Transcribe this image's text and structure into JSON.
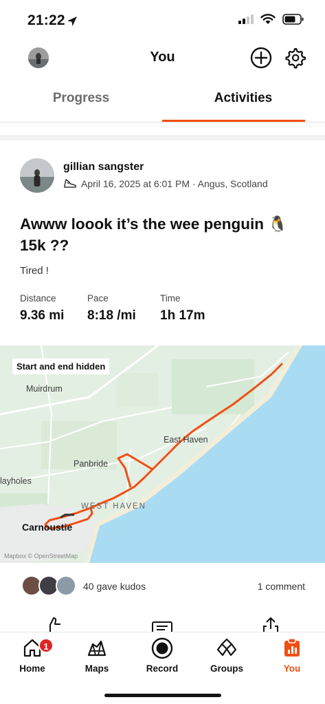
{
  "status_bar": {
    "time": "21:22",
    "location_icon": "location-arrow-icon",
    "signal_icon": "signal-icon",
    "wifi_icon": "wifi-icon",
    "battery_icon": "battery-icon"
  },
  "header": {
    "title": "You",
    "avatar_icon": "profile-avatar",
    "add_icon": "plus-circle-icon",
    "settings_icon": "gear-icon"
  },
  "tabs": [
    {
      "label": "Progress"
    },
    {
      "label": "Activities",
      "active": true
    }
  ],
  "activity": {
    "athlete": "gillian sangster",
    "meta": "April 16, 2025 at 6:01 PM · Angus, Scotland",
    "sport_icon": "shoe-icon",
    "title": "Awww loook it’s the wee penguin 🐧 15k ??",
    "description": "Tired !",
    "stats": [
      {
        "label": "Distance",
        "value": "9.36 mi"
      },
      {
        "label": "Pace",
        "value": "8:18 /mi"
      },
      {
        "label": "Time",
        "value": "1h 17m"
      }
    ],
    "map": {
      "privacy_badge": "Start and end hidden",
      "places": [
        "Muirdrum",
        "East Haven",
        "Panbride",
        "layholes",
        "WEST HAVEN",
        "Carnoustie"
      ],
      "attribution": "Mapbox © OpenStreetMap",
      "route_color": "#f24e12",
      "sea_color": "#a9dcf3",
      "land_color": "#e2efe2"
    },
    "kudos": "40 gave kudos",
    "comments": "1 comment"
  },
  "bottom_nav": [
    {
      "label": "Home",
      "icon": "home-icon",
      "badge": "1"
    },
    {
      "label": "Maps",
      "icon": "map-icon"
    },
    {
      "label": "Record",
      "icon": "record-icon"
    },
    {
      "label": "Groups",
      "icon": "groups-icon"
    },
    {
      "label": "You",
      "icon": "you-icon",
      "active": true
    }
  ],
  "colors": {
    "accent": "#f24e12",
    "badge": "#e02424"
  }
}
